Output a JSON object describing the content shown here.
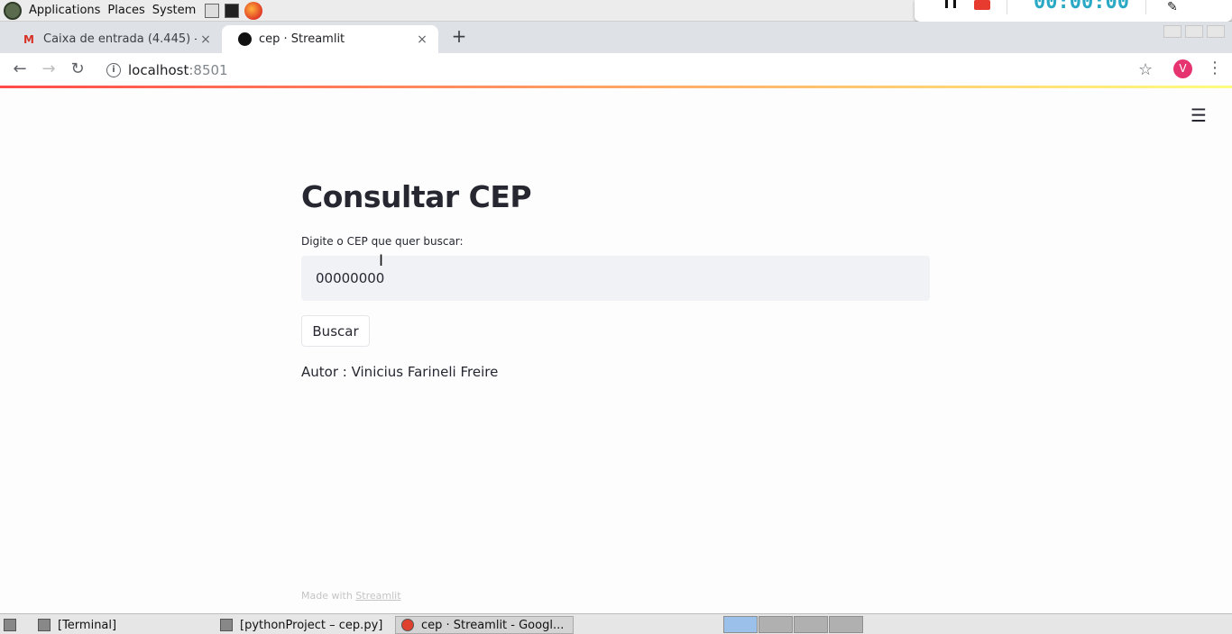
{
  "panel": {
    "menus": [
      "Applications",
      "Places",
      "System"
    ]
  },
  "recorder": {
    "timer": "00:00:00"
  },
  "browser": {
    "tabs": [
      {
        "title": "Caixa de entrada (4.445) -",
        "close": "×"
      },
      {
        "title": "cep · Streamlit",
        "close": "×"
      }
    ],
    "new_tab": "+",
    "url_host": "localhost",
    "url_port": ":8501",
    "avatar_letter": "V"
  },
  "app": {
    "title": "Consultar CEP",
    "input_label": "Digite o CEP que quer buscar:",
    "input_value": "00000000",
    "button_label": "Buscar",
    "author_text": "Autor : Vinicius Farineli Freire",
    "footer_prefix": "Made with ",
    "footer_link": "Streamlit"
  },
  "taskbar": {
    "tasks": [
      "[Terminal]",
      "[pythonProject – cep.py]",
      "cep · Streamlit - Googl..."
    ]
  },
  "colors": {
    "accent_red": "#ff4b4b",
    "input_bg": "#f0f2f6",
    "text": "#262730"
  }
}
